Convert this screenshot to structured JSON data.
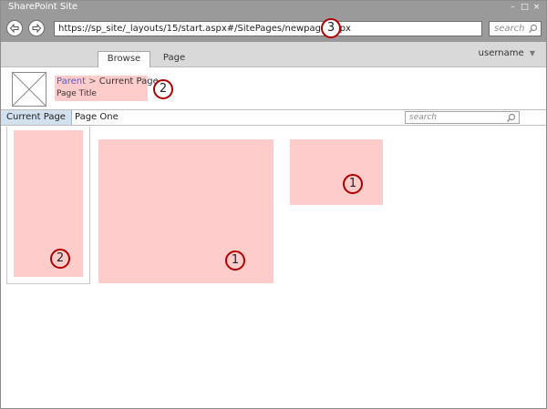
{
  "window": {
    "title": "SharePoint Site",
    "minimize_glyph": "–",
    "maximize_glyph": "□",
    "close_glyph": "×"
  },
  "browser": {
    "back_icon": "back-arrow-icon",
    "forward_icon": "forward-arrow-icon",
    "url": "https://sp_site/_layouts/15/start.aspx#/SitePages/newpage.aspx",
    "search_placeholder": "search"
  },
  "suitebar": {
    "tabs": [
      {
        "label": "Browse",
        "selected": true
      },
      {
        "label": "Page",
        "selected": false
      }
    ],
    "username": "username",
    "username_caret": "▼"
  },
  "header": {
    "logo_icon": "image-placeholder-icon",
    "breadcrumb": {
      "parent": "Parent",
      "separator": ">",
      "current": "Current Page"
    },
    "page_title": "Page Title"
  },
  "topnav": {
    "items": [
      {
        "label": "Current Page",
        "selected": true
      },
      {
        "label": "Page One",
        "selected": false
      }
    ],
    "search_placeholder": "search"
  },
  "callouts": {
    "url": "3",
    "title_area": "2",
    "left_zone": "2",
    "main_large": "1",
    "main_small": "1"
  },
  "colors": {
    "zone_highlight": "#ffcccc",
    "callout_border": "#b20000",
    "chrome": "#9a9a9a",
    "nav_selected": "#d3e0ee",
    "link": "#5b5bb5"
  }
}
